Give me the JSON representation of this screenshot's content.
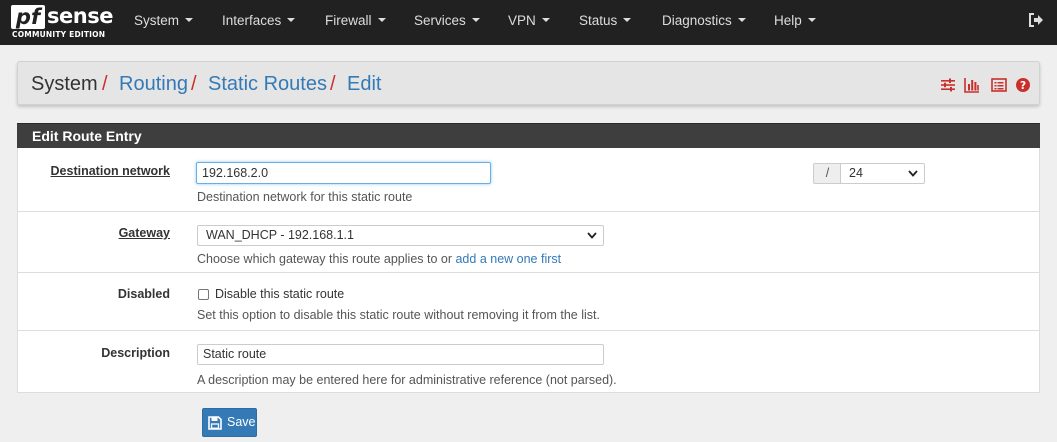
{
  "brand": {
    "logo_mark": "pf",
    "logo_word": "sense",
    "edition": "COMMUNITY EDITION"
  },
  "nav": {
    "items": [
      {
        "label": "System"
      },
      {
        "label": "Interfaces"
      },
      {
        "label": "Firewall"
      },
      {
        "label": "Services"
      },
      {
        "label": "VPN"
      },
      {
        "label": "Status"
      },
      {
        "label": "Diagnostics"
      },
      {
        "label": "Help"
      }
    ],
    "logout_icon": "sign-out-icon"
  },
  "breadcrumb": {
    "items": [
      "System",
      "Routing",
      "Static Routes",
      "Edit"
    ],
    "separator": "/",
    "tools": [
      "sliders-icon",
      "bar-chart-icon",
      "list-alt-icon",
      "question-circle-icon"
    ]
  },
  "panel": {
    "title": "Edit Route Entry",
    "destination": {
      "label": "Destination network",
      "value": "192.168.2.0",
      "mask_prefix": "/",
      "mask_value": "24",
      "help": "Destination network for this static route"
    },
    "gateway": {
      "label": "Gateway",
      "value": "WAN_DHCP - 192.168.1.1",
      "help_prefix": "Choose which gateway this route applies to or ",
      "help_link": "add a new one first"
    },
    "disabled": {
      "label": "Disabled",
      "checkbox_label": "Disable this static route",
      "checked": false,
      "help": "Set this option to disable this static route without removing it from the list."
    },
    "description": {
      "label": "Description",
      "value": "Static route",
      "help": "A description may be entered here for administrative reference (not parsed)."
    }
  },
  "actions": {
    "save_label": "Save",
    "save_icon": "save-icon"
  },
  "colors": {
    "navbar": "#212121",
    "link": "#337ab7",
    "separator": "#c9302c",
    "panel_head": "#3e3e3e",
    "primary": "#337ab7"
  }
}
